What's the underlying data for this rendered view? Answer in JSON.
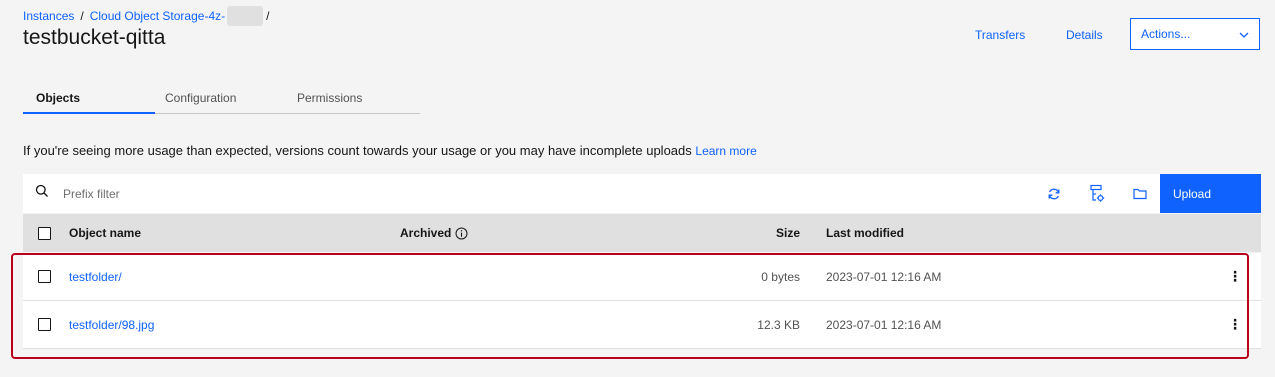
{
  "breadcrumb": {
    "root": "Instances",
    "instance": "Cloud Object Storage-4z-",
    "trail": "/"
  },
  "title": "testbucket-qitta",
  "header": {
    "transfers": "Transfers",
    "details": "Details",
    "actions": "Actions..."
  },
  "tabs": [
    {
      "label": "Objects",
      "active": true
    },
    {
      "label": "Configuration",
      "active": false
    },
    {
      "label": "Permissions",
      "active": false
    }
  ],
  "notice": {
    "text": "If you're seeing more usage than expected, versions count towards your usage or you may have incomplete uploads",
    "link": "Learn more"
  },
  "toolbar": {
    "search_placeholder": "Prefix filter",
    "upload": "Upload"
  },
  "table": {
    "columns": {
      "name": "Object name",
      "archived": "Archived",
      "size": "Size",
      "modified": "Last modified"
    },
    "rows": [
      {
        "name": "testfolder/",
        "size": "0 bytes",
        "modified": "2023-07-01 12:16 AM"
      },
      {
        "name": "testfolder/98.jpg",
        "size": "12.3 KB",
        "modified": "2023-07-01 12:16 AM"
      }
    ]
  },
  "colors": {
    "accent": "#0f62fe",
    "highlight": "#b8001a"
  }
}
